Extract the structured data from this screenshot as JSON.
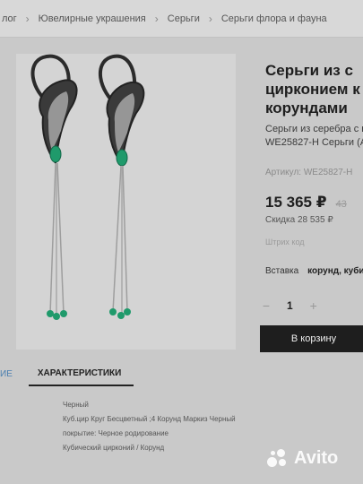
{
  "breadcrumb": {
    "items": [
      "лог",
      "Ювелирные украшения",
      "Серьги",
      "Серьги флора и фауна"
    ]
  },
  "product": {
    "title": "Серьги из с\nцирконием к\nкорундами",
    "description": "Серьги из серебра с куб\nWE25827-H Серьги (Ag 9",
    "article": "Артикул: WE25827-H",
    "price": "15 365 ₽",
    "old_price": "43",
    "discount": "Скидка 28 535 ₽",
    "barcode": "Штрих код",
    "attribute_label": "Вставка",
    "attribute_value": "корунд, кубиче"
  },
  "quantity": {
    "minus": "−",
    "value": "1",
    "plus": "+"
  },
  "cart_button": "В корзину",
  "tabs": [
    "ИЕ",
    "ХАРАКТЕРИСТИКИ"
  ],
  "specs": [
    "Черный",
    "Куб.цир Круг Бесцветный ;4 Корунд Маркиз Черный",
    "покрытие: Черное родирование",
    "Кубический цирконий / Корунд"
  ],
  "watermark": "Avito",
  "colors": {
    "emerald": "#1f9a6b",
    "dark_metal": "#2b2b2b",
    "button": "#1e1e1e"
  }
}
